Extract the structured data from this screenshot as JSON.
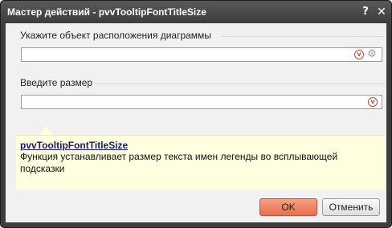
{
  "window": {
    "title": "Мастер действий - pvvTooltipFontTitleSize",
    "help_label": "?",
    "close_label": "✕"
  },
  "fields": [
    {
      "label": "Укажите объект расположения диаграммы",
      "value": "",
      "has_gear": true
    },
    {
      "label": "Введите размер",
      "value": "",
      "has_gear": false
    }
  ],
  "variable_icon": "v",
  "tooltip": {
    "title": "pvvTooltipFontTitleSize",
    "description": "Функция устанавливает размер текста имен легенды во всплывающей подсказки"
  },
  "buttons": {
    "ok": "OK",
    "cancel": "Отменить"
  },
  "colors": {
    "titlebar": "#3e3e3e",
    "ok_accent": "#e76f4d",
    "tooltip_bg": "#ffffdf"
  }
}
